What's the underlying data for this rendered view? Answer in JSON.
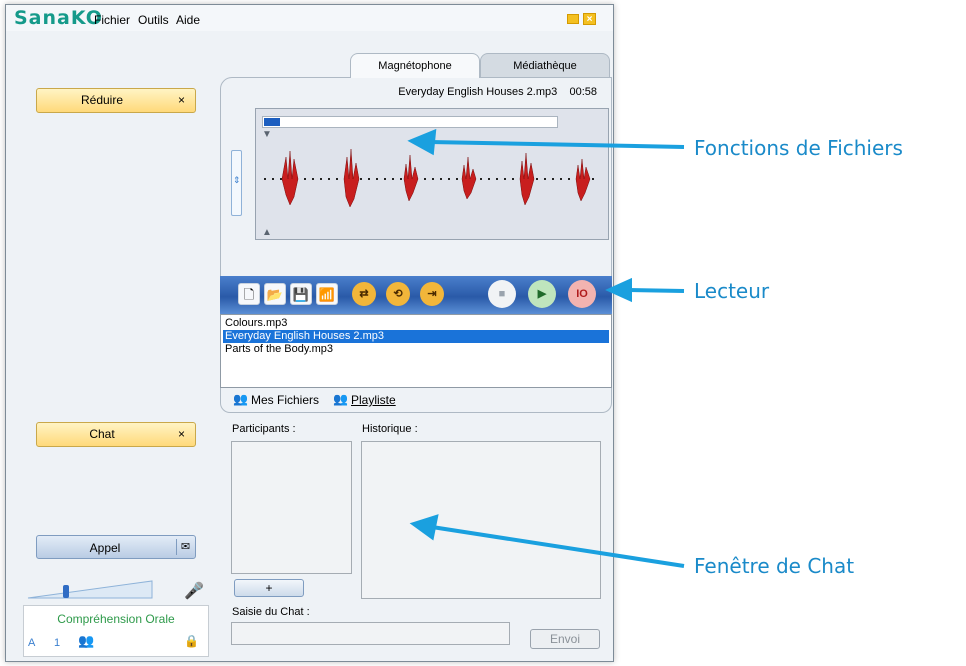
{
  "window": {
    "logo": "SanaKO",
    "menu": [
      "Fichier",
      "Outils",
      "Aide"
    ],
    "close_symbol": "×"
  },
  "left": {
    "reduce_button": "Réduire",
    "chat_button": "Chat",
    "close_symbol": "×",
    "call_button": "Appel",
    "comprehension_label": "Compréhension Orale",
    "comp_row": [
      "A",
      "1"
    ]
  },
  "recorder": {
    "tabs": [
      "Magnétophone",
      "Médiathèque"
    ],
    "current_file": "Everyday English Houses 2.mp3",
    "time": "00:58",
    "record_label": "IO"
  },
  "files": {
    "items": [
      "Colours.mp3",
      "Everyday English Houses 2.mp3",
      "Parts of the Body.mp3"
    ],
    "selected_index": 1,
    "tab_my_files": "Mes Fichiers",
    "tab_playlist": "Playliste"
  },
  "chat": {
    "participants_label": "Participants :",
    "history_label": "Historique :",
    "add_button": "+",
    "input_label": "Saisie du Chat :",
    "send_button": "Envoi"
  },
  "annotations": {
    "file_functions": "Fonctions de Fichiers",
    "player": "Lecteur",
    "chat_window": "Fenêtre de Chat"
  },
  "colors": {
    "accent_blue": "#1a8ac9",
    "selection_blue": "#1a73d9",
    "logo_teal": "#159a8a",
    "button_yellow": "#ffd97a"
  }
}
